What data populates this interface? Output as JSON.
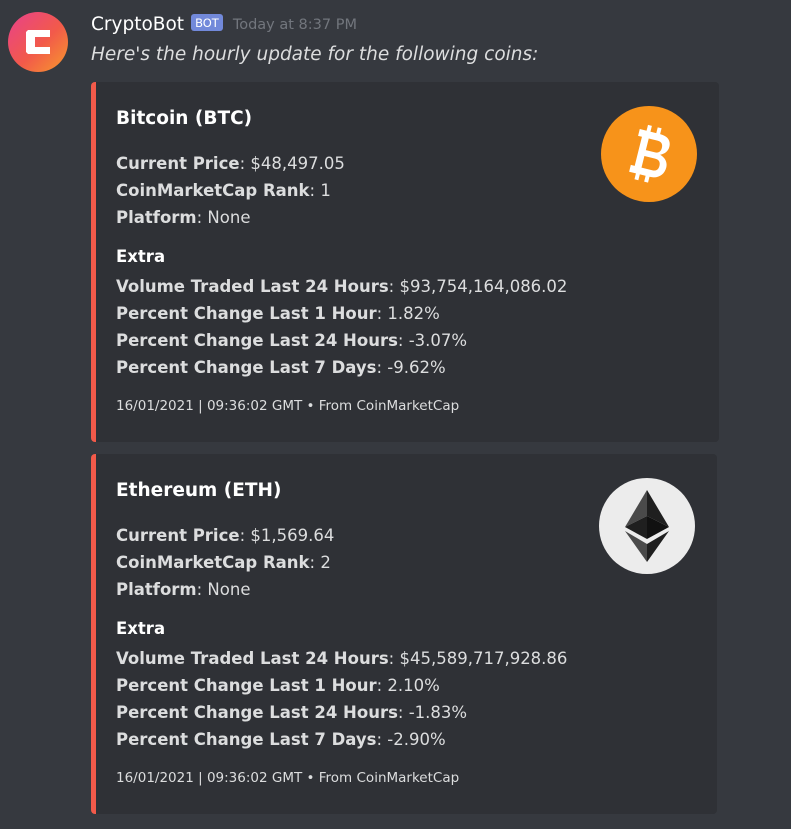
{
  "message": {
    "username": "CryptoBot",
    "badge": "BOT",
    "timestamp": "Today at 8:37 PM",
    "text": "Here's the hourly update for the following coins:",
    "avatar_icon": "crypto-bot-logo-icon"
  },
  "colors": {
    "background": "#36393f",
    "embed_bg": "#2f3136",
    "embed_border": "#f25a4a",
    "badge": "#7289da",
    "bitcoin_orange": "#f7931a",
    "ethereum_circle": "#ececec"
  },
  "embeds": [
    {
      "title": "Bitcoin (BTC)",
      "thumbnail_icon": "bitcoin-icon",
      "fields": [
        {
          "label": "Current Price",
          "value": ": $48,497.05"
        },
        {
          "label": "CoinMarketCap Rank",
          "value": ": 1"
        },
        {
          "label": "Platform",
          "value": ": None"
        }
      ],
      "extra_label": "Extra",
      "extra_fields": [
        {
          "label": "Volume Traded Last 24 Hours",
          "value": ": $93,754,164,086.02"
        },
        {
          "label": "Percent Change Last 1 Hour",
          "value": ": 1.82%"
        },
        {
          "label": "Percent Change Last 24 Hours",
          "value": ": -3.07%"
        },
        {
          "label": "Percent Change Last 7 Days",
          "value": ": -9.62%"
        }
      ],
      "footer": "16/01/2021 | 09:36:02 GMT • From CoinMarketCap"
    },
    {
      "title": "Ethereum (ETH)",
      "thumbnail_icon": "ethereum-icon",
      "fields": [
        {
          "label": "Current Price",
          "value": ": $1,569.64"
        },
        {
          "label": "CoinMarketCap Rank",
          "value": ": 2"
        },
        {
          "label": "Platform",
          "value": ": None"
        }
      ],
      "extra_label": "Extra",
      "extra_fields": [
        {
          "label": "Volume Traded Last 24 Hours",
          "value": ": $45,589,717,928.86"
        },
        {
          "label": "Percent Change Last 1 Hour",
          "value": ": 2.10%"
        },
        {
          "label": "Percent Change Last 24 Hours",
          "value": ": -1.83%"
        },
        {
          "label": "Percent Change Last 7 Days",
          "value": ": -2.90%"
        }
      ],
      "footer": "16/01/2021 | 09:36:02 GMT • From CoinMarketCap"
    }
  ]
}
